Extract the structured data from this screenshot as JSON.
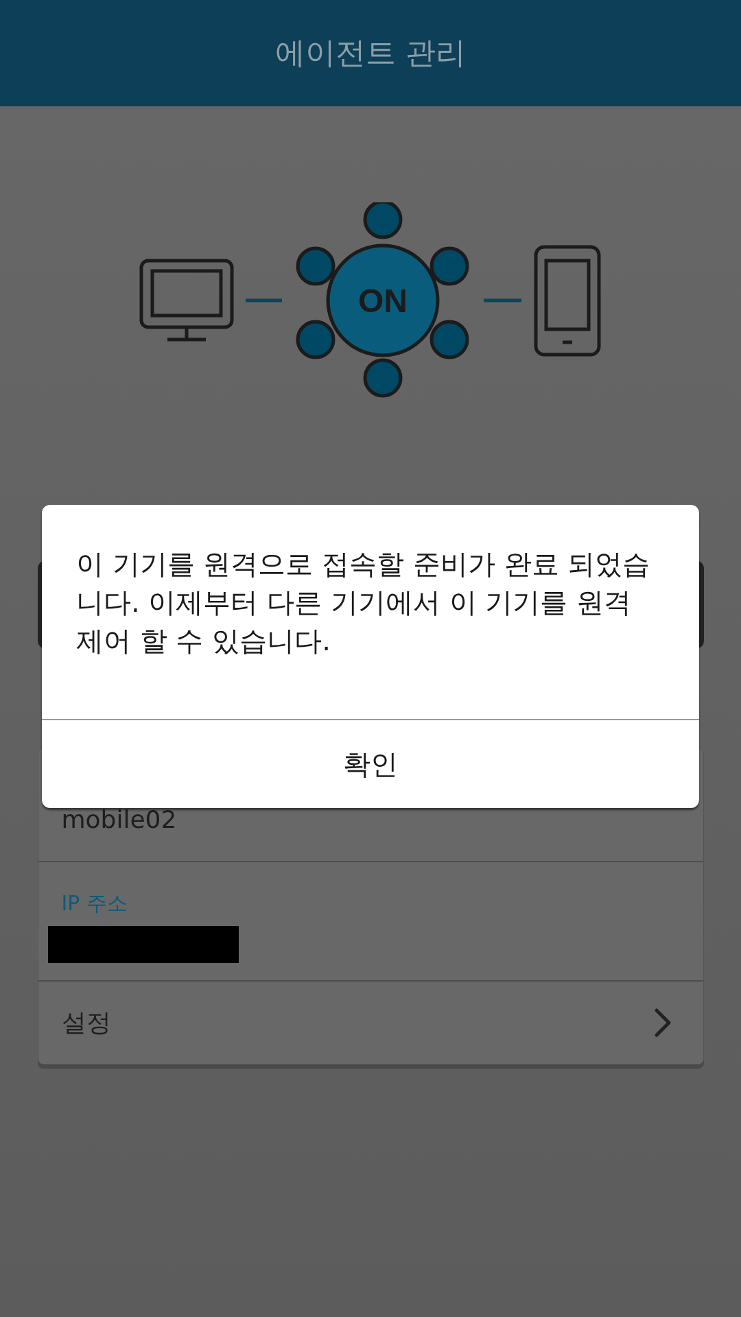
{
  "header": {
    "title": "에이전트 관리"
  },
  "status": {
    "label": "ON"
  },
  "list": [
    {
      "kind": "value",
      "value": "mobile02"
    },
    {
      "kind": "field",
      "label": "IP 주소"
    },
    {
      "kind": "link",
      "label": "설정"
    }
  ],
  "dialog": {
    "message": "이 기기를 원격으로 접속할 준비가 완료 되었습니다. 이제부터 다른 기기에서 이 기기를 원격 제어 할 수 있습니다.",
    "button": "확인"
  }
}
